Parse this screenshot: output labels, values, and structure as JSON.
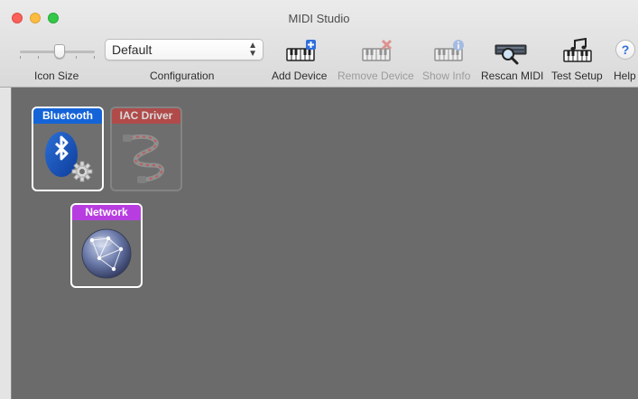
{
  "window": {
    "title": "MIDI Studio"
  },
  "toolbar": {
    "icon_size_label": "Icon Size",
    "configuration_label": "Configuration",
    "configuration_value": "Default",
    "buttons": [
      {
        "label": "Add Device",
        "icon": "keyboard-plus-icon",
        "enabled": true
      },
      {
        "label": "Remove Device",
        "icon": "keyboard-remove-icon",
        "enabled": false
      },
      {
        "label": "Show Info",
        "icon": "keyboard-info-icon",
        "enabled": false
      },
      {
        "label": "Rescan MIDI",
        "icon": "rescan-magnifier-icon",
        "enabled": true
      },
      {
        "label": "Test Setup",
        "icon": "keyboard-music-note-icon",
        "enabled": true
      },
      {
        "label": "Help",
        "icon": "help-icon",
        "enabled": true
      }
    ]
  },
  "devices": [
    {
      "name": "Bluetooth",
      "icon": "bluetooth-gear-icon",
      "color": "#1464d8",
      "online": true
    },
    {
      "name": "IAC Driver",
      "icon": "iac-cable-icon",
      "color": "#c8413f",
      "online": false
    },
    {
      "name": "Network",
      "icon": "network-globe-icon",
      "color": "#b83de0",
      "online": true
    }
  ],
  "colors": {
    "canvas": "#6b6b6b",
    "bluetooth": "#1464d8",
    "iac": "#c8413f",
    "network": "#b83de0",
    "help_accent": "#2f6fdc"
  }
}
